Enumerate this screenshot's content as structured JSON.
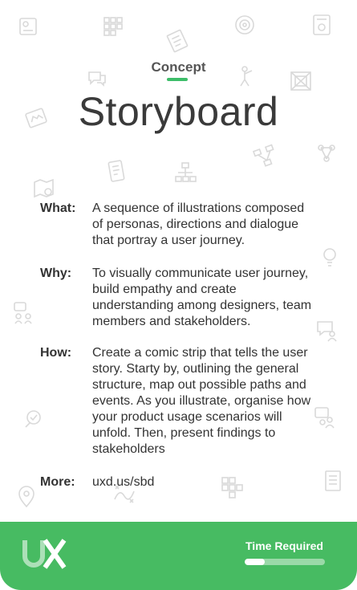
{
  "card": {
    "category": "Concept",
    "title": "Storyboard",
    "sections": {
      "what": {
        "label": "What:",
        "text": "A sequence of illustrations composed of personas, directions and dialogue that portray a user journey."
      },
      "why": {
        "label": "Why:",
        "text": "To visually communicate user journey, build empathy and create understanding among designers, team members and stakeholders."
      },
      "how": {
        "label": "How:",
        "text": "Create a comic strip that tells the user story. Starty by, outlining the general structure, map out possible paths and events. As you illustrate, organise how your product usage scenarios will unfold. Then, present findings to stakeholders"
      },
      "more": {
        "label": "More:",
        "text": "uxd.us/sbd"
      }
    }
  },
  "footer": {
    "logo_text": "UX",
    "time_label": "Time Required",
    "time_level": 0.25
  },
  "colors": {
    "accent": "#47bb62",
    "kicker_bar": "#3dbd69",
    "text": "#333333",
    "title": "#3a3a3a"
  },
  "background_icons": [
    "persona-card-icon",
    "grid-icon",
    "document-icon",
    "target-icon",
    "browser-icon",
    "chat-icon",
    "person-icon",
    "wireframe-icon",
    "sketch-icon",
    "network-icon",
    "flowchart-icon",
    "tablet-icon",
    "hierarchy-icon",
    "map-icon",
    "blocks-icon",
    "bulb-icon",
    "feedback-icon",
    "lightbulb-icon",
    "checklist-icon",
    "location-icon",
    "journey-icon",
    "sticky-notes-icon",
    "notes-icon",
    "teamwork-icon",
    "chat-person-icon"
  ]
}
